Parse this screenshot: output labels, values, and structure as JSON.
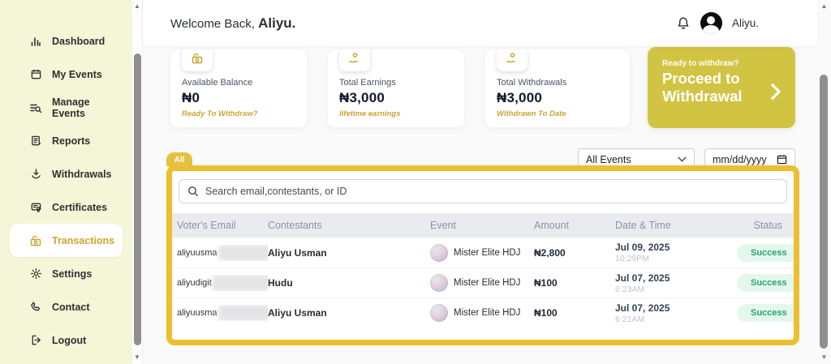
{
  "colors": {
    "gold": "#ecbf31",
    "gold-dark": "#c9a62f",
    "pill-gold": "#e4c23f",
    "olive": "#d2c443",
    "sidebar-bg": "#f5f6d8",
    "success-bg": "#e4f7ed",
    "success-text": "#27a376",
    "thead-bg": "#e9ebee",
    "thead-text": "#8a94a6"
  },
  "sidebar": {
    "items": [
      {
        "label": "Dashboard",
        "icon": "bar-chart-icon",
        "active": false
      },
      {
        "label": "My Events",
        "icon": "calendar-icon",
        "active": false
      },
      {
        "label": "Manage Events",
        "icon": "search-list-icon",
        "active": false
      },
      {
        "label": "Reports",
        "icon": "report-icon",
        "active": false
      },
      {
        "label": "Withdrawals",
        "icon": "withdraw-icon",
        "active": false
      },
      {
        "label": "Certificates",
        "icon": "certificate-icon",
        "active": false
      },
      {
        "label": "Transactions",
        "icon": "cash-icon",
        "active": true
      },
      {
        "label": "Settings",
        "icon": "gear-icon",
        "active": false
      },
      {
        "label": "Contact",
        "icon": "phone-icon",
        "active": false
      },
      {
        "label": "Logout",
        "icon": "logout-icon",
        "active": false
      }
    ]
  },
  "header": {
    "welcome_prefix": "Welcome Back, ",
    "welcome_name": "Aliyu.",
    "user_name": "Aliyu."
  },
  "stats": {
    "cards": [
      {
        "label": "Available Balance",
        "value": "₦0",
        "sublabel": "Ready To Withdraw?",
        "icon": "wallet-icon"
      },
      {
        "label": "Total Earnings",
        "value": "₦3,000",
        "sublabel": "lifetime earnings",
        "icon": "hand-coin-icon"
      },
      {
        "label": "Total Withdrawals",
        "value": "₦3,000",
        "sublabel": "Withdrawn To Date",
        "icon": "hand-coin-icon"
      }
    ],
    "withdraw_card": {
      "eyebrow": "Ready to withdraw?",
      "title": "Proceed to Withdrawal"
    }
  },
  "filters": {
    "tab": "All",
    "event_select": "All Events",
    "date_placeholder": "mm/dd/yyyy"
  },
  "search": {
    "placeholder": "Search email,contestants, or ID"
  },
  "table": {
    "columns": [
      "Voter's Email",
      "Contestants",
      "Event",
      "Amount",
      "Date & Time",
      "Status"
    ],
    "rows": [
      {
        "email": "aliyuusma",
        "contestant": "Aliyu Usman",
        "event": "Mister Elite HDJ",
        "amount": "₦2,800",
        "date": "Jul 09, 2025",
        "time": "10:29PM",
        "status": "Success"
      },
      {
        "email": "aliyudigit",
        "contestant": "Hudu",
        "event": "Mister Elite HDJ",
        "amount": "₦100",
        "date": "Jul 07, 2025",
        "time": "6:23AM",
        "status": "Success"
      },
      {
        "email": "aliyuusma",
        "contestant": "Aliyu Usman",
        "event": "Mister Elite HDJ",
        "amount": "₦100",
        "date": "Jul 07, 2025",
        "time": "6:21AM",
        "status": "Success"
      }
    ]
  }
}
